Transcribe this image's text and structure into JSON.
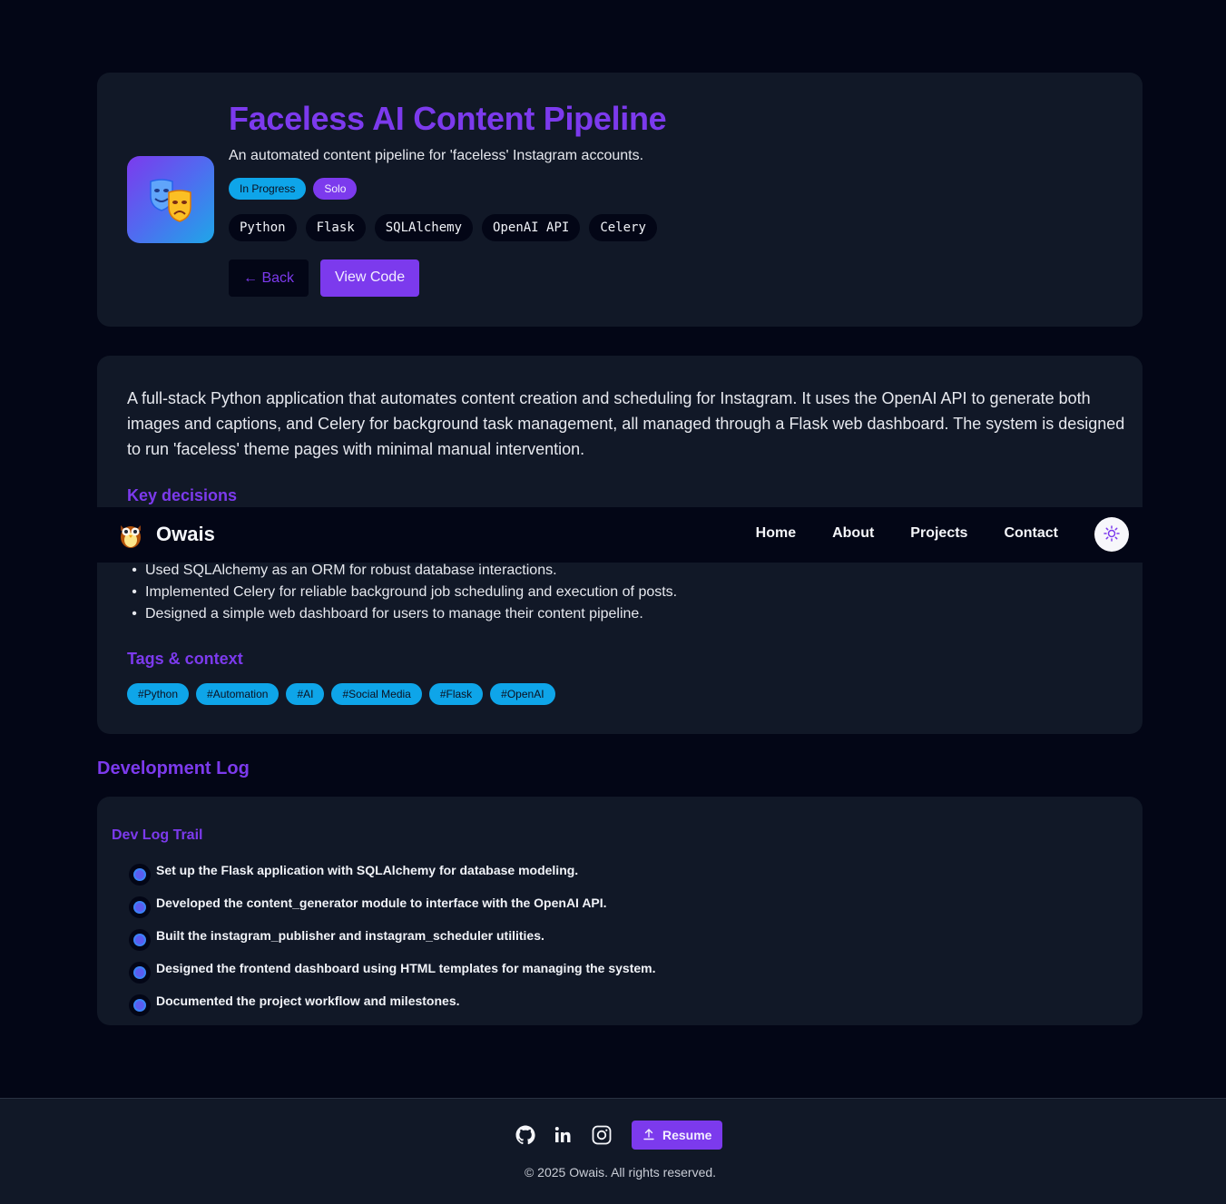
{
  "project": {
    "title": "Faceless AI Content Pipeline",
    "subtitle": "An automated content pipeline for 'faceless' Instagram accounts.",
    "icon": "theater-masks-icon",
    "badges": [
      "In Progress",
      "Solo"
    ],
    "stack": [
      "Python",
      "Flask",
      "SQLAlchemy",
      "OpenAI API",
      "Celery"
    ],
    "back_label": "← Back",
    "code_label": "View Code"
  },
  "details": {
    "description": "A full-stack Python application that automates content creation and scheduling for Instagram. It uses the OpenAI API to generate both images and captions, and Celery for background task management, all managed through a Flask web dashboard. The system is designed to run 'faceless' theme pages with minimal manual intervention.",
    "key_decisions_heading": "Key decisions",
    "decisions": [
      "Used SQLAlchemy as an ORM for robust database interactions.",
      "Implemented Celery for reliable background job scheduling and execution of posts.",
      "Designed a simple web dashboard for users to manage their content pipeline."
    ],
    "tags_heading": "Tags & context",
    "tags": [
      "#Python",
      "#Automation",
      "#AI",
      "#Social Media",
      "#Flask",
      "#OpenAI"
    ]
  },
  "navbar": {
    "brand": "Owais",
    "links": [
      "Home",
      "About",
      "Projects",
      "Contact"
    ],
    "theme_icon": "sun-icon"
  },
  "devlog": {
    "heading": "Development Log",
    "trail_heading": "Dev Log Trail",
    "entries": [
      "Set up the Flask application with SQLAlchemy for database modeling.",
      "Developed the content_generator module to interface with the OpenAI API.",
      "Built the instagram_publisher and instagram_scheduler utilities.",
      "Designed the frontend dashboard using HTML templates for managing the system.",
      "Documented the project workflow and milestones."
    ]
  },
  "footer": {
    "resume_label": "Resume",
    "copyright": "© 2025 Owais. All rights reserved."
  },
  "colors": {
    "background": "#030616",
    "card": "#111827",
    "accent": "#7c3aed",
    "tag": "#0ea5e9"
  }
}
